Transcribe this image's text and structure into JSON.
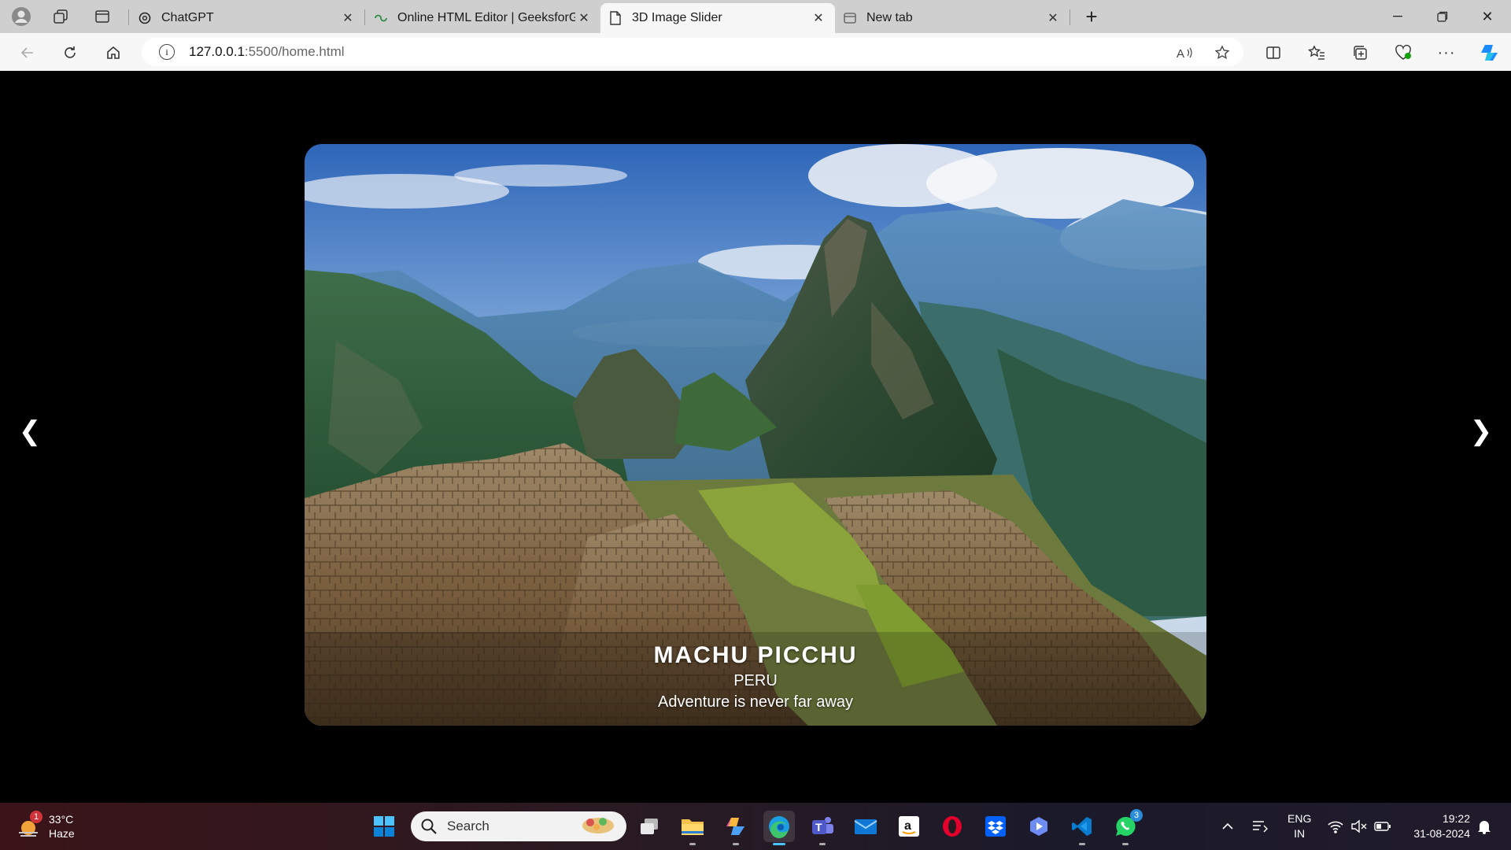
{
  "browser": {
    "tabs": [
      {
        "title": "ChatGPT",
        "icon": "openai-icon",
        "active": false
      },
      {
        "title": "Online HTML Editor | GeeksforGe",
        "icon": "geeksforgeeks-icon",
        "active": false
      },
      {
        "title": "3D Image Slider",
        "icon": "page-icon",
        "active": true
      },
      {
        "title": "New tab",
        "icon": "new-tab-icon",
        "active": false
      }
    ],
    "address": {
      "host": "127.0.0.1",
      "rest": ":5500/home.html"
    }
  },
  "slider": {
    "title": "MACHU PICCHU",
    "subtitle": "PERU",
    "tagline": "Adventure is never far away",
    "prev_glyph": "❮",
    "next_glyph": "❯"
  },
  "taskbar": {
    "weather": {
      "temp": "33°C",
      "condition": "Haze",
      "badge": "1"
    },
    "search_placeholder": "Search",
    "apps": [
      "start-icon",
      "search",
      "task-view-icon",
      "file-explorer-icon",
      "copilot-icon",
      "edge-icon",
      "teams-icon",
      "mail-icon",
      "amazon-icon",
      "opera-icon",
      "dropbox-icon",
      "windows-app-icon",
      "vscode-icon",
      "whatsapp-icon"
    ],
    "whatsapp_badge": "3",
    "language": {
      "line1": "ENG",
      "line2": "IN"
    },
    "clock": {
      "time": "19:22",
      "date": "31-08-2024"
    }
  },
  "colors": {
    "accent": "#0a5cd6",
    "page_bg": "#000000",
    "tabbar_bg": "#cfcfcf"
  }
}
